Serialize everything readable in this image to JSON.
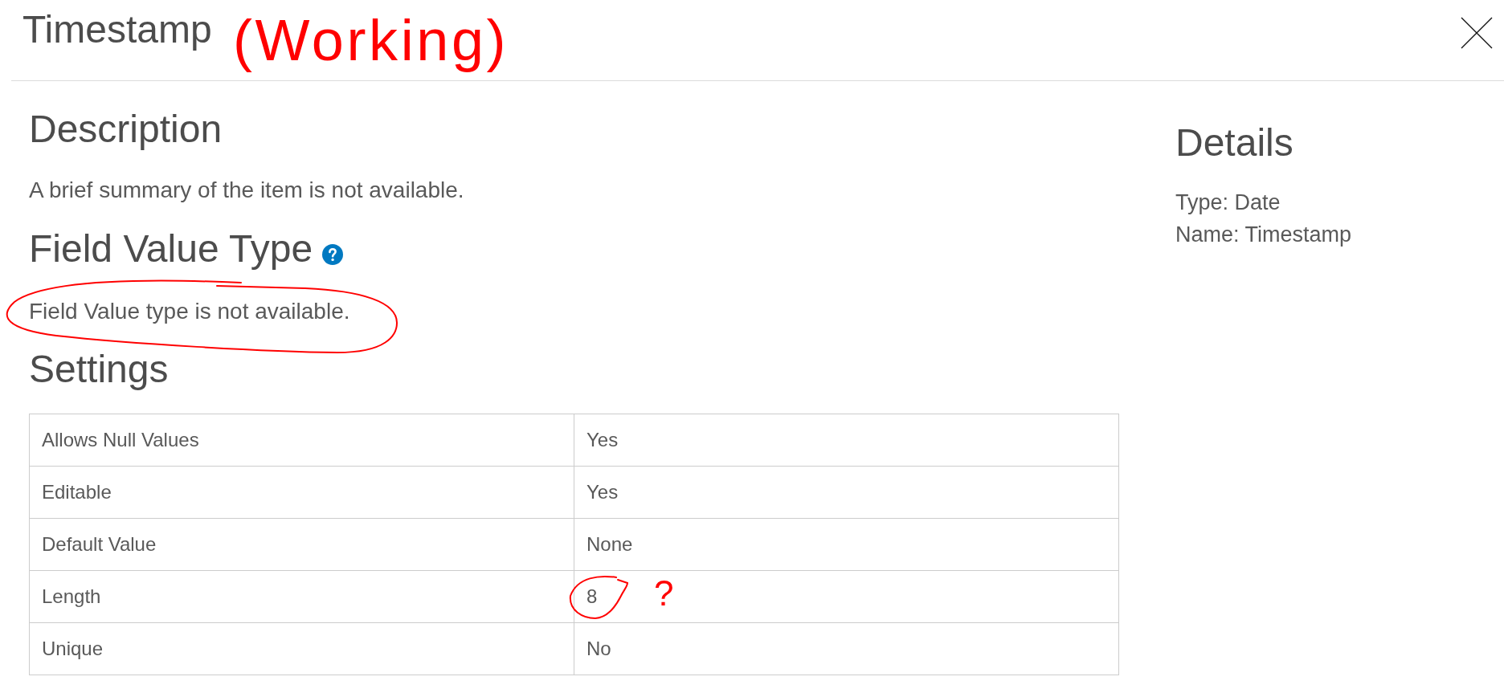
{
  "window": {
    "title": "Timestamp",
    "annotation": "(Working)"
  },
  "description": {
    "heading": "Description",
    "text": "A brief summary of the item is not available."
  },
  "field_value_type": {
    "heading": "Field Value Type",
    "text": "Field Value type is not available.",
    "circled": true
  },
  "settings": {
    "heading": "Settings",
    "rows": [
      {
        "label": "Allows Null Values",
        "value": "Yes",
        "circled": false
      },
      {
        "label": "Editable",
        "value": "Yes",
        "circled": false
      },
      {
        "label": "Default Value",
        "value": "None",
        "circled": false
      },
      {
        "label": "Length",
        "value": "8",
        "circled": true,
        "annotation": "?"
      },
      {
        "label": "Unique",
        "value": "No",
        "circled": false
      }
    ]
  },
  "details": {
    "heading": "Details",
    "lines": [
      "Type: Date",
      "Name: Timestamp"
    ]
  }
}
